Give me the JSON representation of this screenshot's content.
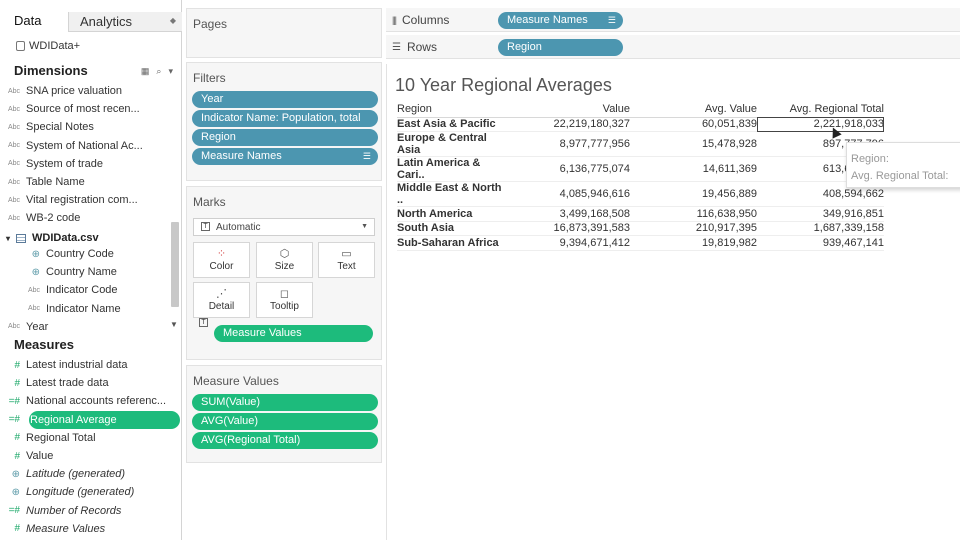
{
  "data_pane": {
    "tab_data": "Data",
    "tab_analytics": "Analytics",
    "datasource": "WDIData+",
    "dimensions_header": "Dimensions",
    "dimensions": [
      {
        "icon": "Abc",
        "label": "SNA price valuation"
      },
      {
        "icon": "Abc",
        "label": "Source of most recen..."
      },
      {
        "icon": "Abc",
        "label": "Special Notes"
      },
      {
        "icon": "Abc",
        "label": "System of National Ac..."
      },
      {
        "icon": "Abc",
        "label": "System of trade"
      },
      {
        "icon": "Abc",
        "label": "Table Name"
      },
      {
        "icon": "Abc",
        "label": "Vital registration com..."
      },
      {
        "icon": "Abc",
        "label": "WB-2 code"
      }
    ],
    "table_name": "WDIData.csv",
    "table_fields": [
      {
        "icon": "globe",
        "label": "Country Code"
      },
      {
        "icon": "globe",
        "label": "Country Name"
      },
      {
        "icon": "Abc",
        "label": "Indicator Code"
      },
      {
        "icon": "Abc",
        "label": "Indicator Name"
      },
      {
        "icon": "Abc",
        "label": "Year"
      }
    ],
    "measures_header": "Measures",
    "measures": [
      {
        "icon": "#",
        "label": "Latest industrial data"
      },
      {
        "icon": "#",
        "label": "Latest trade data"
      },
      {
        "icon": "=#",
        "label": "National accounts referenc..."
      },
      {
        "icon": "=#",
        "label": "Regional Average",
        "selected": true
      },
      {
        "icon": "#",
        "label": "Regional Total"
      },
      {
        "icon": "#",
        "label": "Value"
      },
      {
        "icon": "globe",
        "label": "Latitude (generated)",
        "italic": true
      },
      {
        "icon": "globe",
        "label": "Longitude (generated)",
        "italic": true
      },
      {
        "icon": "=#",
        "label": "Number of Records",
        "italic": true
      },
      {
        "icon": "#",
        "label": "Measure Values",
        "italic": true
      }
    ]
  },
  "pages": {
    "title": "Pages"
  },
  "filters": {
    "title": "Filters",
    "items": [
      "Year",
      "Indicator Name: Population, total",
      "Region",
      "Measure Names"
    ]
  },
  "marks": {
    "title": "Marks",
    "type": "Automatic",
    "buttons": [
      {
        "label": "Color",
        "icon": "color-icon"
      },
      {
        "label": "Size",
        "icon": "size-icon"
      },
      {
        "label": "Text",
        "icon": "text-icon"
      },
      {
        "label": "Detail",
        "icon": "detail-icon"
      },
      {
        "label": "Tooltip",
        "icon": "tooltip-icon"
      }
    ],
    "text_pill": "Measure Values"
  },
  "measure_values": {
    "title": "Measure Values",
    "items": [
      "SUM(Value)",
      "AVG(Value)",
      "AVG(Regional Total)"
    ]
  },
  "shelves": {
    "columns_label": "Columns",
    "columns_pill": "Measure Names",
    "rows_label": "Rows",
    "rows_pill": "Region"
  },
  "view": {
    "title": "10 Year Regional Averages",
    "headers": [
      "Region",
      "Value",
      "Avg. Value",
      "Avg. Regional Total"
    ],
    "rows": [
      [
        "East Asia & Pacific",
        "22,219,180,327",
        "60,051,839",
        "2,221,918,033"
      ],
      [
        "Europe & Central Asia",
        "8,977,777,956",
        "15,478,928",
        "897,777,796"
      ],
      [
        "Latin America & Cari..",
        "6,136,775,074",
        "14,611,369",
        "613,677,507"
      ],
      [
        "Middle East & North ..",
        "4,085,946,616",
        "19,456,889",
        "408,594,662"
      ],
      [
        "North America",
        "3,499,168,508",
        "116,638,950",
        "349,916,851"
      ],
      [
        "South Asia",
        "16,873,391,583",
        "210,917,395",
        "1,687,339,158"
      ],
      [
        "Sub-Saharan Africa",
        "9,394,671,412",
        "19,819,982",
        "939,467,141"
      ]
    ],
    "tooltip": {
      "line1": "Region:",
      "line2": "Avg. Regional Total:"
    }
  },
  "colors": {
    "blue_pill": "#4c96b0",
    "green_pill": "#1dbb7c"
  }
}
